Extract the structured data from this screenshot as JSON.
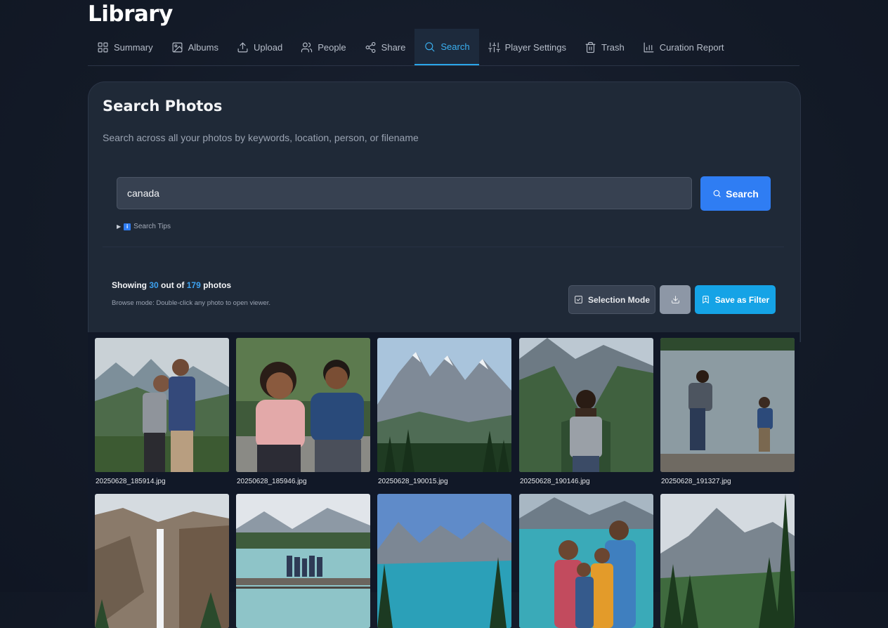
{
  "app": {
    "title": "Library"
  },
  "nav": {
    "tabs": [
      {
        "label": "Summary",
        "icon": "grid-icon"
      },
      {
        "label": "Albums",
        "icon": "album-icon"
      },
      {
        "label": "Upload",
        "icon": "upload-icon"
      },
      {
        "label": "People",
        "icon": "people-icon"
      },
      {
        "label": "Share",
        "icon": "share-icon"
      },
      {
        "label": "Search",
        "icon": "search-icon",
        "active": true
      },
      {
        "label": "Player Settings",
        "icon": "sliders-icon"
      },
      {
        "label": "Trash",
        "icon": "trash-icon"
      },
      {
        "label": "Curation Report",
        "icon": "bar-chart-icon"
      }
    ]
  },
  "search": {
    "heading": "Search Photos",
    "subtitle": "Search across all your photos by keywords, location, person, or filename",
    "query": "canada",
    "button_label": "Search",
    "tips_label": "Search Tips"
  },
  "results": {
    "showing_prefix": "Showing",
    "shown": "30",
    "middle": "out of",
    "total": "179",
    "suffix": "photos",
    "hint": "Browse mode: Double-click any photo to open viewer.",
    "selection_label": "Selection Mode",
    "save_filter_label": "Save as Filter"
  },
  "photos": [
    {
      "filename": "20250628_185914.jpg"
    },
    {
      "filename": "20250628_185946.jpg"
    },
    {
      "filename": "20250628_190015.jpg"
    },
    {
      "filename": "20250628_190146.jpg"
    },
    {
      "filename": "20250628_191327.jpg"
    },
    {
      "filename": ""
    },
    {
      "filename": ""
    },
    {
      "filename": ""
    },
    {
      "filename": ""
    },
    {
      "filename": ""
    }
  ],
  "colors": {
    "accent": "#2f7df3",
    "active_tab": "#3ab0f0",
    "filter_button": "#15a3e6"
  }
}
